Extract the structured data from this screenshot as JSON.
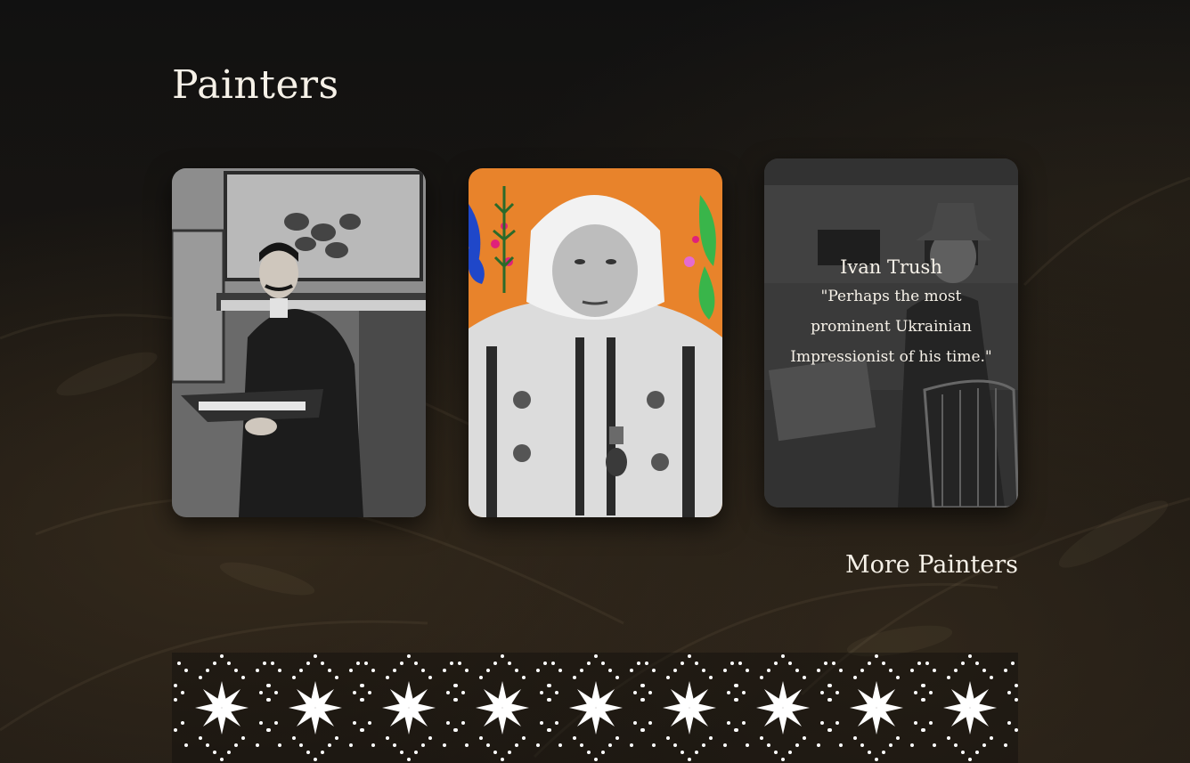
{
  "page": {
    "title": "Painters",
    "more_link": "More Painters"
  },
  "cards": [
    {
      "name": "",
      "quote": "",
      "photo": "black-and-white photo of mustached man in suit seated in studio holding a portfolio"
    },
    {
      "name": "",
      "quote": "",
      "photo": "photo of elderly woman in white headscarf and embroidered blouse on orange floral background"
    },
    {
      "name": "Ivan Trush",
      "quote": "\"Perhaps the most prominent Ukrainian Impressionist of his time.\"",
      "photo": "black-and-white photo of man in hat painting outdoors at an easel"
    }
  ],
  "ornament": {
    "icon": "eight-point-star-icon",
    "color": "#ffffff"
  },
  "colors": {
    "background": "#16130f",
    "text": "#f6f1e8",
    "accent_orange": "#e8832b"
  }
}
